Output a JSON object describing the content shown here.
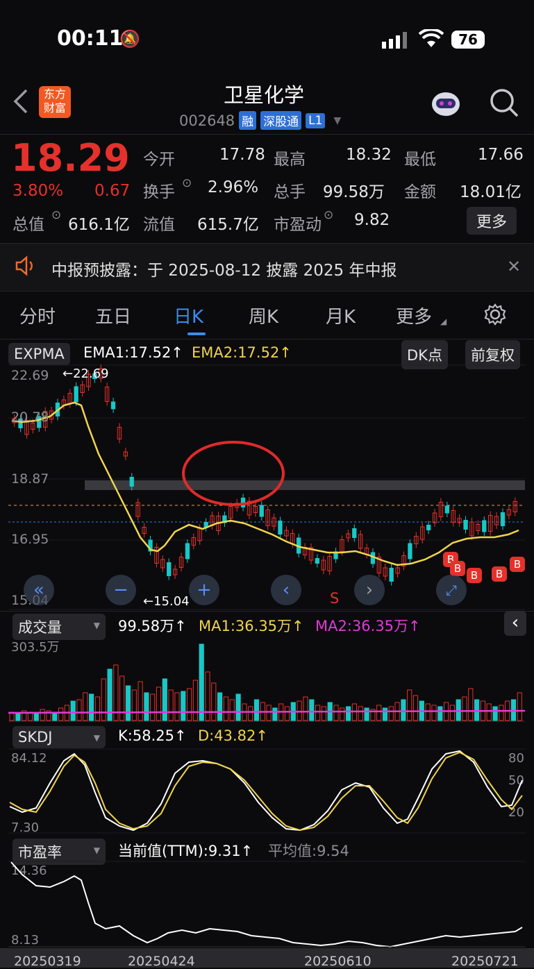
{
  "status_bar": {
    "time": "00:11",
    "battery": "76"
  },
  "header": {
    "back": "<",
    "logo_line1": "东方",
    "logo_line2": "财富",
    "title": "卫星化学",
    "code": "002648",
    "badges": [
      "融",
      "深股通",
      "L1"
    ]
  },
  "quote": {
    "price": "18.29",
    "change_pct": "3.80%",
    "change": "0.67",
    "rows": [
      [
        {
          "label": "今开",
          "value": "17.78",
          "color": "red"
        },
        {
          "label": "最高",
          "value": "18.32",
          "color": "red"
        },
        {
          "label": "最低",
          "value": "17.66",
          "color": "red"
        }
      ],
      [
        {
          "label": "换手",
          "value": "2.96%",
          "color": "white"
        },
        {
          "label": "总手",
          "value": "99.58万",
          "color": "white"
        },
        {
          "label": "金额",
          "value": "18.01亿",
          "color": "white"
        }
      ],
      [
        {
          "label": "总值",
          "value": "616.1亿",
          "color": "white"
        },
        {
          "label": "流值",
          "value": "615.7亿",
          "color": "white"
        },
        {
          "label": "市盈动",
          "value": "9.82",
          "color": "white"
        }
      ]
    ],
    "more_button": "更多"
  },
  "notice": {
    "text": "中报预披露：于 2025-08-12 披露 2025 年中报"
  },
  "tabs": [
    "分时",
    "五日",
    "日K",
    "周K",
    "月K",
    "更多"
  ],
  "active_tab": 2,
  "kline": {
    "indicator": "EXPMA",
    "ema1": "EMA1:17.52↑",
    "ema2": "EMA2:17.52↑",
    "dk_button": "DK点",
    "adjust_button": "前复权",
    "y_labels": [
      "22.69",
      "20.78",
      "18.87",
      "16.95",
      "15.04"
    ],
    "high_marker": "22.69",
    "low_marker": "15.04",
    "sell_marker": "S",
    "buy_marker": "B"
  },
  "volume": {
    "selector": "成交量",
    "value": "99.58万↑",
    "ma1": "MA1:36.35万↑",
    "ma2": "MA2:36.35万↑",
    "y_max": "303.5万"
  },
  "skdj": {
    "selector": "SKDJ",
    "k": "K:58.25↑",
    "d": "D:43.82↑",
    "y_max": "84.12",
    "y_min": "7.30",
    "right_labels": [
      "80",
      "50",
      "20"
    ]
  },
  "pe": {
    "selector": "市盈率",
    "current": "当前值(TTM):9.31↑",
    "avg": "平均值:9.54",
    "y_max": "14.36",
    "y_min": "8.13"
  },
  "dates": [
    "20250319",
    "20250424",
    "20250610",
    "20250721"
  ],
  "colors": {
    "up": "#e5312b",
    "down": "#19c7c7",
    "ema": "#f1d54a",
    "accent": "#3a8cf0"
  }
}
